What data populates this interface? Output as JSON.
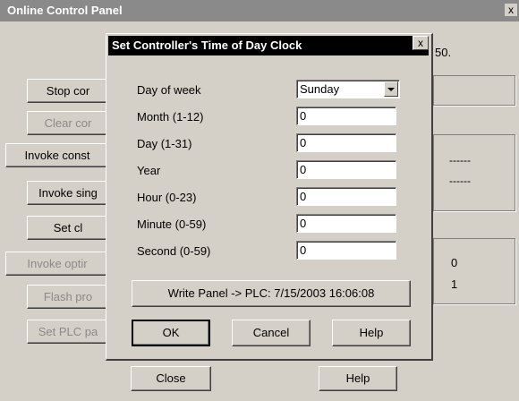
{
  "background_window": {
    "title": "Online Control Panel",
    "close_glyph": "x",
    "partial_text": "50.",
    "buttons": [
      {
        "label": "Stop cor",
        "disabled": false
      },
      {
        "label": "Clear cor",
        "disabled": true
      },
      {
        "label": "Invoke const",
        "disabled": false
      },
      {
        "label": "Invoke sing",
        "disabled": false
      },
      {
        "label": "Set cl",
        "disabled": false
      },
      {
        "label": "Invoke optir",
        "disabled": true
      },
      {
        "label": "Flash pro",
        "disabled": true
      },
      {
        "label": "Set PLC pa",
        "disabled": true
      }
    ],
    "status_dashes": [
      "------",
      "------"
    ],
    "status_values": [
      "0",
      "1"
    ],
    "close_button": "Close",
    "help_button": "Help"
  },
  "dialog": {
    "title": "Set Controller's Time of Day Clock",
    "close_glyph": "x",
    "fields": [
      {
        "label": "Day of week",
        "value": "Sunday",
        "type": "select"
      },
      {
        "label": "Month (1-12)",
        "value": "0",
        "type": "text"
      },
      {
        "label": "Day (1-31)",
        "value": "0",
        "type": "text"
      },
      {
        "label": "Year",
        "value": "0",
        "type": "text"
      },
      {
        "label": "Hour (0-23)",
        "value": "0",
        "type": "text"
      },
      {
        "label": "Minute (0-59)",
        "value": "0",
        "type": "text"
      },
      {
        "label": "Second (0-59)",
        "value": "0",
        "type": "text"
      }
    ],
    "write_button": "Write Panel -> PLC:  7/15/2003 16:06:08",
    "ok_button": "OK",
    "cancel_button": "Cancel",
    "help_button": "Help"
  }
}
